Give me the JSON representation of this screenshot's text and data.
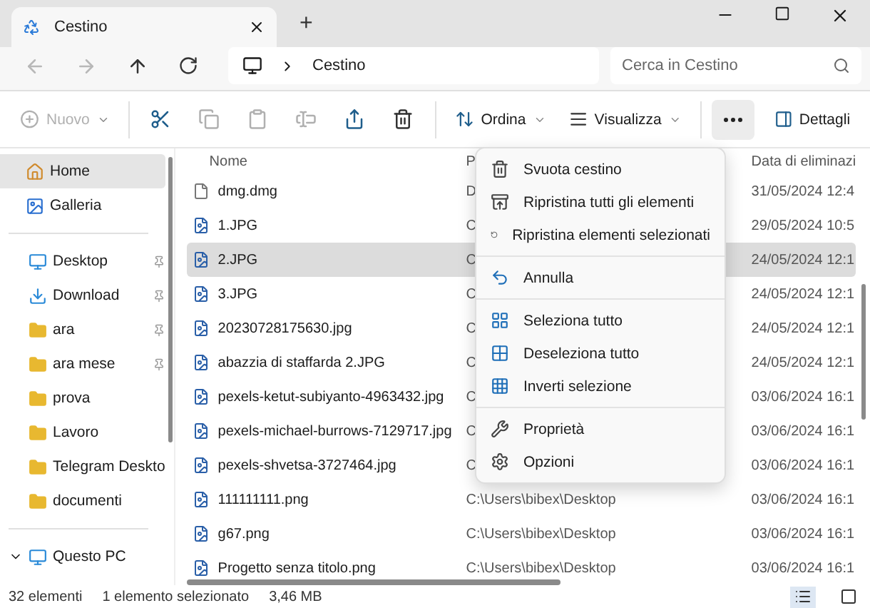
{
  "window": {
    "tab_title": "Cestino",
    "new_tab": "+"
  },
  "navigation": {
    "back_disabled": true,
    "forward_disabled": true,
    "breadcrumb": [
      "Cestino"
    ],
    "search": {
      "placeholder": "Cerca in Cestino"
    }
  },
  "toolbar": [
    {
      "kind": "dropdown",
      "label": "Nuovo",
      "disabled": true
    },
    {
      "kind": "icon",
      "disabled": false
    },
    {
      "kind": "icon",
      "disabled": true
    },
    {
      "kind": "icon",
      "disabled": true
    },
    {
      "kind": "icon",
      "disabled": true
    },
    {
      "kind": "icon",
      "disabled": false
    },
    {
      "kind": "icon",
      "disabled": false
    },
    {
      "kind": "dropdown",
      "label": "Ordina",
      "disabled": false
    },
    {
      "kind": "dropdown",
      "label": "Visualizza",
      "disabled": false
    },
    {
      "kind": "more",
      "pressed": true
    },
    {
      "kind": "toggle",
      "label": "Dettagli",
      "disabled": false
    }
  ],
  "sidebar": {
    "items": [
      {
        "label": "Home",
        "selected": true,
        "pinned": false,
        "kind": "home"
      },
      {
        "label": "Galleria",
        "selected": false,
        "pinned": false,
        "kind": "gallery"
      },
      {
        "kind": "divider"
      },
      {
        "label": "Desktop",
        "selected": false,
        "pinned": true,
        "kind": "desktop"
      },
      {
        "label": "Download",
        "selected": false,
        "pinned": true,
        "kind": "download"
      },
      {
        "label": "ara",
        "selected": false,
        "pinned": true,
        "kind": "folder"
      },
      {
        "label": "ara mese",
        "selected": false,
        "pinned": true,
        "kind": "folder"
      },
      {
        "label": "prova",
        "selected": false,
        "pinned": false,
        "kind": "folder"
      },
      {
        "label": "Lavoro",
        "selected": false,
        "pinned": false,
        "kind": "folder"
      },
      {
        "label": "Telegram Deskto",
        "selected": false,
        "pinned": false,
        "kind": "folder"
      },
      {
        "label": "documenti",
        "selected": false,
        "pinned": false,
        "kind": "folder"
      },
      {
        "kind": "divider"
      },
      {
        "label": "Questo PC",
        "selected": false,
        "pinned": false,
        "kind": "pc"
      }
    ]
  },
  "table": {
    "columns": [
      "Nome",
      "P",
      "Data di eliminazi"
    ],
    "rows": [
      {
        "name": "dmg.dmg",
        "kind": "file",
        "path": "D",
        "date": "31/05/2024 12:4",
        "selected": false
      },
      {
        "name": "1.JPG",
        "kind": "image",
        "path": "C",
        "date": "29/05/2024 10:5",
        "selected": false
      },
      {
        "name": "2.JPG",
        "kind": "image",
        "path": "C",
        "date": "24/05/2024 12:1",
        "selected": true
      },
      {
        "name": "3.JPG",
        "kind": "image",
        "path": "C",
        "date": "24/05/2024 12:1",
        "selected": false
      },
      {
        "name": "20230728175630.jpg",
        "kind": "image",
        "path": "C",
        "date": "24/05/2024 12:1",
        "selected": false
      },
      {
        "name": "abazzia di staffarda 2.JPG",
        "kind": "image",
        "path": "C",
        "date": "24/05/2024 12:1",
        "selected": false
      },
      {
        "name": "pexels-ketut-subiyanto-4963432.jpg",
        "kind": "image",
        "path": "C",
        "date": "03/06/2024 16:1",
        "selected": false
      },
      {
        "name": "pexels-michael-burrows-7129717.jpg",
        "kind": "image",
        "path": "C",
        "date": "03/06/2024 16:1",
        "selected": false
      },
      {
        "name": "pexels-shvetsa-3727464.jpg",
        "kind": "image",
        "path": "C",
        "date": "03/06/2024 16:1",
        "selected": false
      },
      {
        "name": "111111111.png",
        "kind": "image",
        "path": "C:\\Users\\bibex\\Desktop",
        "date": "03/06/2024 16:1",
        "selected": false
      },
      {
        "name": "g67.png",
        "kind": "image",
        "path": "C:\\Users\\bibex\\Desktop",
        "date": "03/06/2024 16:1",
        "selected": false
      },
      {
        "name": "Progetto senza titolo.png",
        "kind": "image",
        "path": "C:\\Users\\bibex\\Desktop",
        "date": "03/06/2024 16:1",
        "selected": false
      }
    ]
  },
  "context_menu": {
    "groups": [
      [
        "Svuota cestino",
        "Ripristina tutti gli elementi",
        "Ripristina elementi selezionati"
      ],
      [
        "Annulla"
      ],
      [
        "Seleziona tutto",
        "Deseleziona tutto",
        "Inverti selezione"
      ],
      [
        "Proprietà",
        "Opzioni"
      ]
    ]
  },
  "status_bar": {
    "count": "32 elementi",
    "selection": "1 elemento selezionato",
    "size": "3,46 MB",
    "views": [
      {
        "kind": "details",
        "selected": true
      },
      {
        "kind": "tiles",
        "selected": false
      }
    ]
  }
}
